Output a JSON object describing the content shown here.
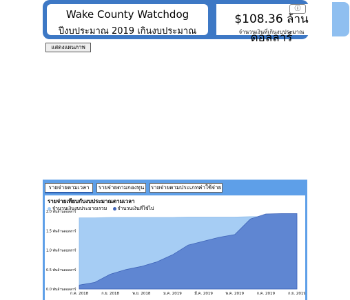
{
  "header": {
    "title": "Wake County Watchdog",
    "subtitle": "ปีงบประมาณ 2019 เกินงบประมาณ",
    "total_amount": "$108.36 ล้านดอลลาร์",
    "total_caption": "จำนวนเงินที่เกินงบประมาณ",
    "info_icon": "ⓘ"
  },
  "toolbar": {
    "show_map_label": "แสดงแผนภาพ"
  },
  "tabs": [
    {
      "label": "รายจ่ายตามเวลา",
      "active": true
    },
    {
      "label": "รายจ่ายตามกองทุน",
      "active": false
    },
    {
      "label": "รายจ่ายตามประเภทค่าใช้จ่าย",
      "active": false
    }
  ],
  "colors": {
    "banner": "#3d78c5",
    "panel": "#5e9fe8",
    "budget_fill": "#a6cdf4",
    "spent_fill": "#5f86d2"
  },
  "chart_data": {
    "type": "area",
    "title": "รายจ่ายเทียบกับงบประมาณตามเวลา",
    "x_tick_labels": [
      "ก.ค. 2018",
      "ก.ย. 2018",
      "พ.ย. 2018",
      "ม.ค. 2019",
      "มี.ค. 2019",
      "พ.ค. 2019",
      "ก.ค. 2019",
      "ก.ย. 2019"
    ],
    "y_tick_labels": [
      "0.0 พันล้านดอลลาร์",
      "0.5 พันล้านดอลลาร์",
      "1.0 พันล้านดอลลาร์",
      "1.5 พันล้านดอลลาร์",
      "2.0 พันล้านดอลลาร์"
    ],
    "ylim": [
      0,
      2.0
    ],
    "y_unit": "billion USD",
    "x": [
      "2018-07",
      "2018-08",
      "2018-09",
      "2018-10",
      "2018-11",
      "2018-12",
      "2019-01",
      "2019-02",
      "2019-03",
      "2019-04",
      "2019-05",
      "2019-06",
      "2019-07",
      "2019-08",
      "2019-09"
    ],
    "series": [
      {
        "name": "จำนวนเงินงบประมาณรวม",
        "color": "#a6cdf4",
        "values": [
          1.83,
          1.83,
          1.84,
          1.84,
          1.84,
          1.84,
          1.84,
          1.85,
          1.85,
          1.85,
          1.85,
          1.86,
          1.86,
          1.86,
          1.86
        ]
      },
      {
        "name": "จำนวนเงินที่ใช้ไป",
        "color": "#5f86d2",
        "values": [
          0.1,
          0.17,
          0.38,
          0.5,
          0.58,
          0.7,
          0.88,
          1.13,
          1.23,
          1.33,
          1.4,
          1.8,
          1.93,
          1.94,
          1.94
        ]
      }
    ],
    "grid": false,
    "legend_position": "top-left"
  }
}
